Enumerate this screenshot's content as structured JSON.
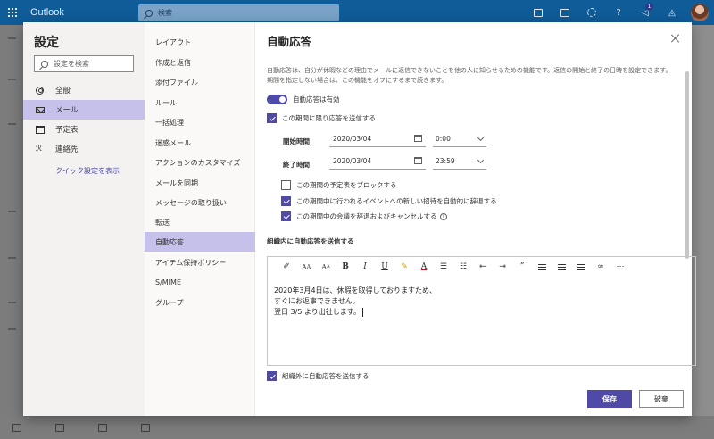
{
  "app": {
    "brand": "Outlook",
    "search_placeholder": "検索",
    "notification_count": "1"
  },
  "settings": {
    "title": "設定",
    "search_placeholder": "設定を検索",
    "categories": [
      {
        "label": "全般",
        "icon": "gear-icon"
      },
      {
        "label": "メール",
        "icon": "mail-icon"
      },
      {
        "label": "予定表",
        "icon": "calendar-icon"
      },
      {
        "label": "連絡先",
        "icon": "people-icon"
      }
    ],
    "quick_settings_link": "クイック設定を表示",
    "subitems": [
      "レイアウト",
      "作成と返信",
      "添付ファイル",
      "ルール",
      "一括処理",
      "迷惑メール",
      "アクションのカスタマイズ",
      "メールを同期",
      "メッセージの取り扱い",
      "転送",
      "自動応答",
      "アイテム保持ポリシー",
      "S/MIME",
      "グループ"
    ]
  },
  "auto_reply": {
    "title": "自動応答",
    "description": "自動応答は、自分が休暇などの理由でメールに返信できないことを他の人に知らせるための機能です。返信の開始と終了の日時を設定できます。期間を指定しない場合は、この機能をオフにするまで続きます。",
    "toggle_label": "自動応答は有効",
    "period_checkbox": "この期間に限り応答を送信する",
    "start_label": "開始時間",
    "start_date": "2020/03/04",
    "start_time": "0:00",
    "end_label": "終了時間",
    "end_date": "2020/03/04",
    "end_time": "23:59",
    "block_calendar": "この期間の予定表をブロックする",
    "decline_invites": "この期間中に行われるイベントへの新しい招待を自動的に辞退する",
    "decline_meetings": "この期間中の会議を辞退およびキャンセルする",
    "internal_section": "組織内に自動応答を送信する",
    "message": "2020年3月4日は、休暇を取得しておりますため、\nすぐにお返事できません。\n翌日 3/5 より出社します。",
    "external_checkbox": "組織外に自動応答を送信する",
    "save": "保存",
    "discard": "破棄"
  },
  "colors": {
    "accent": "#4f4aa6",
    "selected": "#c6c1ea",
    "topbar": "#0f5c99"
  }
}
